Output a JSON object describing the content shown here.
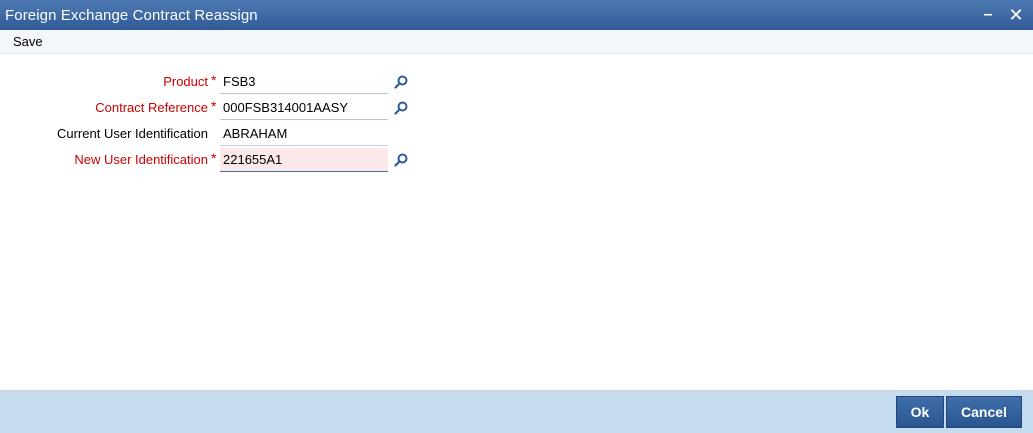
{
  "window": {
    "title": "Foreign Exchange Contract Reassign",
    "minimize_glyph": "–",
    "close_glyph": "✕"
  },
  "toolbar": {
    "save_label": "Save"
  },
  "form": {
    "product": {
      "label": "Product",
      "required_mark": "*",
      "value": "FSB3"
    },
    "contract_reference": {
      "label": "Contract Reference",
      "required_mark": "*",
      "value": "000FSB314001AASY"
    },
    "current_user": {
      "label": "Current User Identification",
      "value": "ABRAHAM"
    },
    "new_user": {
      "label": "New User Identification",
      "required_mark": "*",
      "value": "221655A1"
    }
  },
  "footer": {
    "ok_label": "Ok",
    "cancel_label": "Cancel"
  },
  "colors": {
    "titlebar": "#3a659f",
    "required_label": "#cc0000",
    "active_field_bg": "#fce8e8",
    "footer_bg": "#c5dcef",
    "button_bg": "#2f5b95"
  },
  "icons": {
    "lookup": "search-icon"
  }
}
